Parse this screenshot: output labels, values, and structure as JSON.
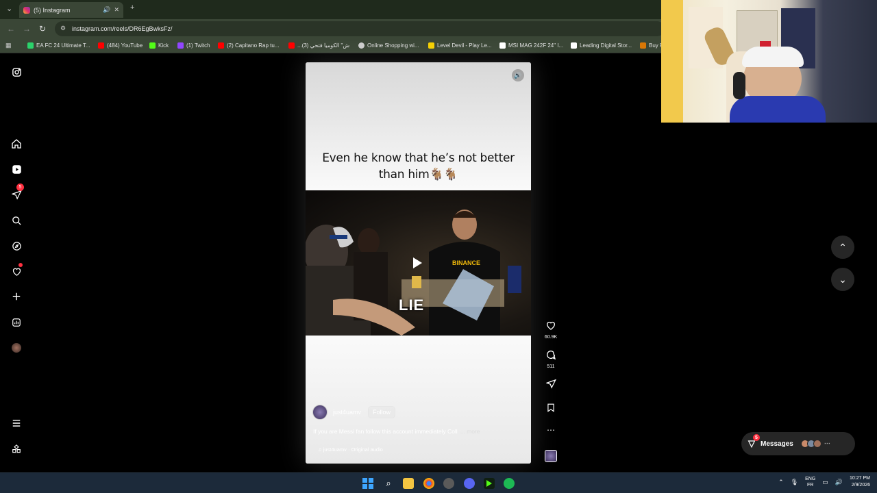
{
  "browser": {
    "tab_title": "(5) Instagram",
    "new_tab": "+",
    "url": "instagram.com/reels/DR6EgBwksFz/",
    "bookmarks": [
      {
        "label": "EA FC 24 Ultimate T...",
        "color": "#2bd26b"
      },
      {
        "label": "(484) YouTube",
        "color": "#ff0000"
      },
      {
        "label": "Kick",
        "color": "#53fc18"
      },
      {
        "label": "(1) Twitch",
        "color": "#9146ff"
      },
      {
        "label": "(2) Capitano Rap tu...",
        "color": "#ff0000"
      },
      {
        "label": "...ش\" الكوميا فتحي (3)",
        "color": "#ff0000"
      },
      {
        "label": "Online Shopping wi...",
        "color": "#cccccc"
      },
      {
        "label": "Level Devil - Play Le...",
        "color": "#f5d000"
      },
      {
        "label": "MSI MAG 242F 24\" I...",
        "color": "#ffffff"
      },
      {
        "label": "Leading Digital Stor...",
        "color": "#ffffff"
      },
      {
        "label": "Buy R",
        "color": "#d97706"
      }
    ]
  },
  "sidebar": {
    "notifications_badge": "5",
    "icons": [
      "instagram-logo-icon",
      "home-icon",
      "reels-icon",
      "direct-icon",
      "search-icon",
      "explore-icon",
      "heart-icon",
      "create-icon",
      "dashboard-icon",
      "profile-avatar",
      "menu-icon",
      "more-icon"
    ]
  },
  "reel": {
    "caption_line1": "Even he know that he’s not better",
    "caption_line2": "than him🐐🐐",
    "overlay_word": "LIE",
    "shirt_text": "BINANCE",
    "username": "just4uamv",
    "follow_label": "Follow",
    "description": "If you are Messi fan follow this account immediately Coll",
    "more_label": "... more",
    "audio": "just4uamv · Original audio"
  },
  "actions": {
    "likes": "60.9K",
    "comments": "511"
  },
  "messages": {
    "label": "Messages",
    "badge": "5"
  },
  "tray": {
    "lang1": "ENG",
    "lang2": "FR",
    "time": "10:27 PM",
    "date": "2/9/2026"
  },
  "colors": {
    "accent_red": "#ff3040",
    "chrome_green": "#3a4636"
  }
}
